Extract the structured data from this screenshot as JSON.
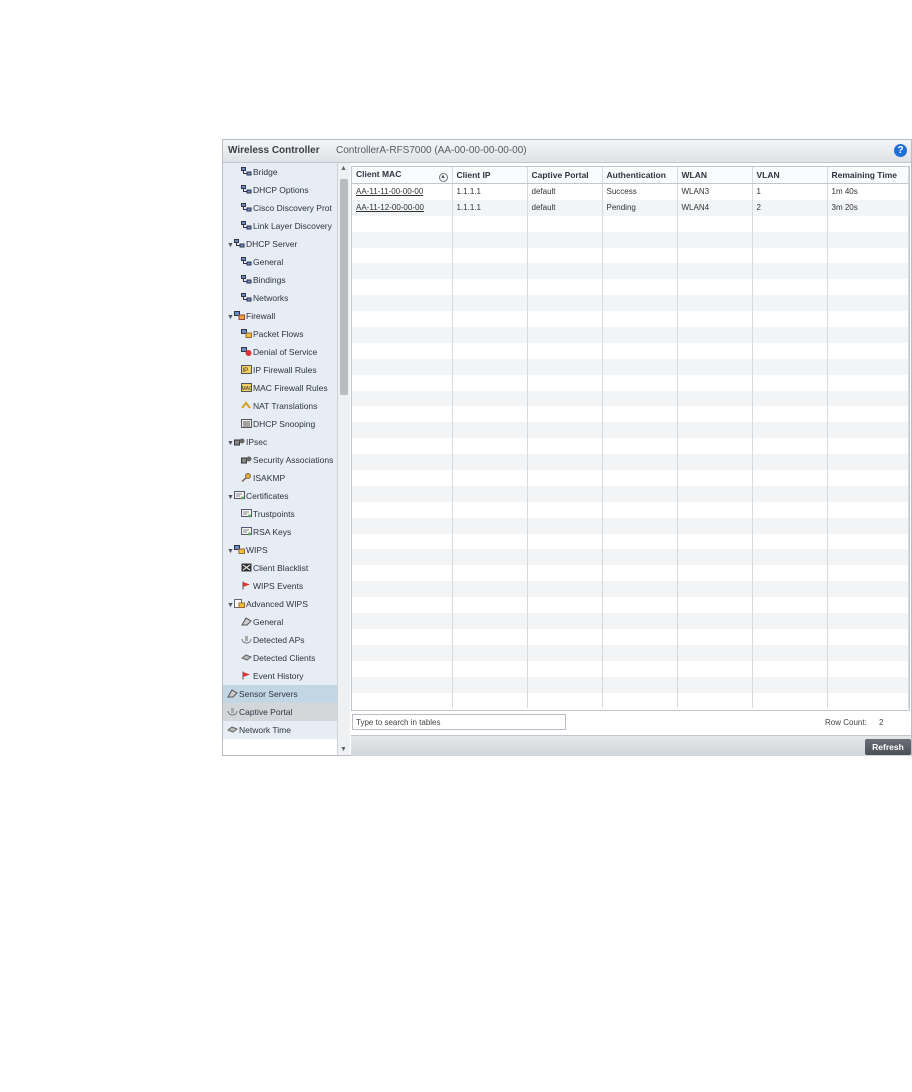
{
  "header": {
    "app_title": "Wireless Controller",
    "device_title": "ControllerA-RFS7000 (AA-00-00-00-00-00)",
    "help_icon": "help-icon"
  },
  "sidebar": {
    "items": [
      {
        "label": "Bridge",
        "level": 1,
        "icon": "network-icon"
      },
      {
        "label": "DHCP Options",
        "level": 1,
        "icon": "network-icon"
      },
      {
        "label": "Cisco Discovery Prot",
        "level": 1,
        "icon": "network-icon"
      },
      {
        "label": "Link Layer Discovery",
        "level": 1,
        "icon": "network-icon"
      },
      {
        "label": "DHCP Server",
        "level": 0,
        "icon": "network-icon",
        "expanded": true
      },
      {
        "label": "General",
        "level": 1,
        "icon": "network-icon"
      },
      {
        "label": "Bindings",
        "level": 1,
        "icon": "network-icon"
      },
      {
        "label": "Networks",
        "level": 1,
        "icon": "network-icon"
      },
      {
        "label": "Firewall",
        "level": 0,
        "icon": "firewall-icon",
        "expanded": true
      },
      {
        "label": "Packet Flows",
        "level": 1,
        "icon": "packet-flows-icon"
      },
      {
        "label": "Denial of Service",
        "level": 1,
        "icon": "denial-of-service-icon"
      },
      {
        "label": "IP Firewall Rules",
        "level": 1,
        "icon": "ip-firewall-icon"
      },
      {
        "label": "MAC Firewall Rules",
        "level": 1,
        "icon": "mac-firewall-icon"
      },
      {
        "label": "NAT Translations",
        "level": 1,
        "icon": "nat-icon"
      },
      {
        "label": "DHCP Snooping",
        "level": 1,
        "icon": "dhcp-snooping-icon"
      },
      {
        "label": "IPsec",
        "level": 0,
        "icon": "ipsec-icon",
        "expanded": true
      },
      {
        "label": "Security Associations",
        "level": 1,
        "icon": "ipsec-icon"
      },
      {
        "label": "ISAKMP",
        "level": 1,
        "icon": "key-icon"
      },
      {
        "label": "Certificates",
        "level": 0,
        "icon": "certificate-icon",
        "expanded": true
      },
      {
        "label": "Trustpoints",
        "level": 1,
        "icon": "certificate-icon"
      },
      {
        "label": "RSA Keys",
        "level": 1,
        "icon": "certificate-icon"
      },
      {
        "label": "WIPS",
        "level": 0,
        "icon": "wips-icon",
        "expanded": true
      },
      {
        "label": "Client Blacklist",
        "level": 1,
        "icon": "blacklist-icon"
      },
      {
        "label": "WIPS Events",
        "level": 1,
        "icon": "event-flag-icon"
      },
      {
        "label": "Advanced WIPS",
        "level": 0,
        "icon": "advanced-wips-icon",
        "expanded": true
      },
      {
        "label": "General",
        "level": 1,
        "icon": "sensor-icon"
      },
      {
        "label": "Detected APs",
        "level": 1,
        "icon": "ap-icon"
      },
      {
        "label": "Detected Clients",
        "level": 1,
        "icon": "client-icon"
      },
      {
        "label": "Event History",
        "level": 1,
        "icon": "event-flag-icon"
      },
      {
        "label": "Sensor Servers",
        "level": 0,
        "icon": "sensor-icon",
        "state": "highlight"
      },
      {
        "label": "Captive Portal",
        "level": 0,
        "icon": "ap-icon",
        "state": "selected"
      },
      {
        "label": "Network Time",
        "level": 0,
        "icon": "client-icon"
      }
    ]
  },
  "table": {
    "columns": [
      "Client MAC",
      "Client IP",
      "Captive Portal",
      "Authentication",
      "WLAN",
      "VLAN",
      "Remaining Time"
    ],
    "rows": [
      [
        "AA-11-11-00-00-00",
        "1.1.1.1",
        "default",
        "Success",
        "WLAN3",
        "1",
        "1m 40s"
      ],
      [
        "AA-11-12-00-00-00",
        "1.1.1.1",
        "default",
        "Pending",
        "WLAN4",
        "2",
        "3m 20s"
      ]
    ],
    "empty_rows": 31
  },
  "footer": {
    "search_placeholder": "Type to search in tables",
    "row_count_label": "Row Count:",
    "row_count_value": "2",
    "refresh_label": "Refresh"
  },
  "colors": {
    "accent": "#1f6fd6",
    "selected": "#c3d6e4",
    "button": "#555a62"
  }
}
